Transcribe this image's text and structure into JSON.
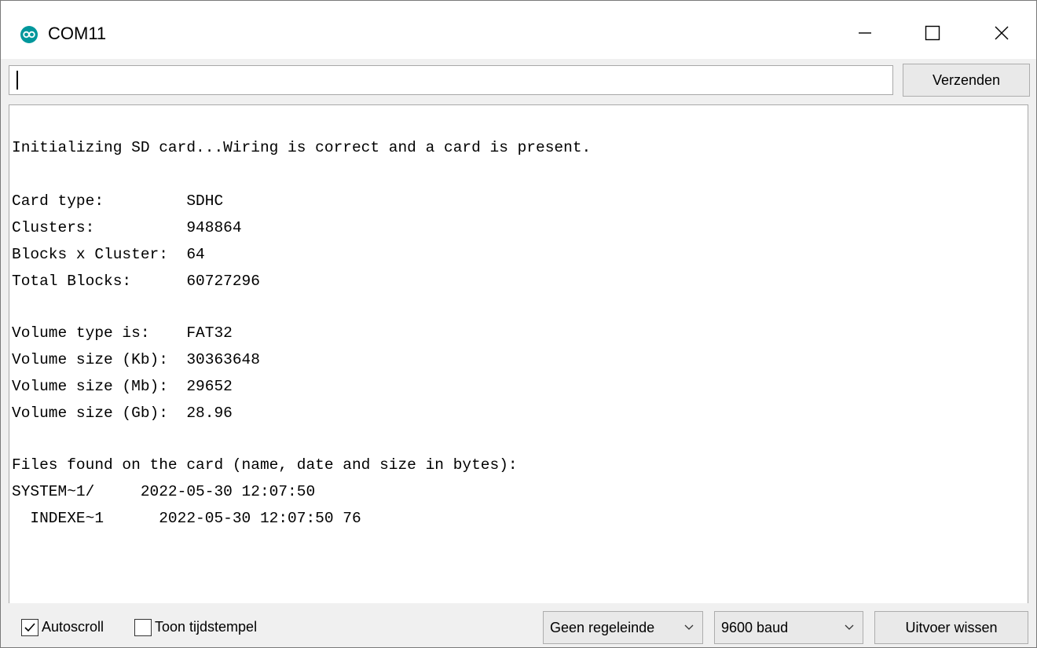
{
  "window": {
    "title": "COM11",
    "icon": "arduino-icon",
    "controls": [
      "minimize-icon",
      "maximize-icon",
      "close-icon"
    ]
  },
  "input": {
    "value": "",
    "send_label": "Verzenden"
  },
  "output": {
    "lines": [
      "Initializing SD card...Wiring is correct and a card is present.",
      "",
      "Card type:         SDHC",
      "Clusters:          948864",
      "Blocks x Cluster:  64",
      "Total Blocks:      60727296",
      "",
      "Volume type is:    FAT32",
      "Volume size (Kb):  30363648",
      "Volume size (Mb):  29652",
      "Volume size (Gb):  28.96",
      "",
      "Files found on the card (name, date and size in bytes):",
      "SYSTEM~1/     2022-05-30 12:07:50",
      "  INDEXE~1      2022-05-30 12:07:50 76"
    ]
  },
  "bottom": {
    "autoscroll_label": "Autoscroll",
    "autoscroll_checked": true,
    "timestamp_label": "Toon tijdstempel",
    "timestamp_checked": false,
    "line_ending": "Geen regeleinde",
    "baud": "9600 baud",
    "clear_label": "Uitvoer wissen"
  },
  "colors": {
    "accent": "#00979c",
    "chrome": "#f0f0f0",
    "button": "#e9e9e9"
  }
}
